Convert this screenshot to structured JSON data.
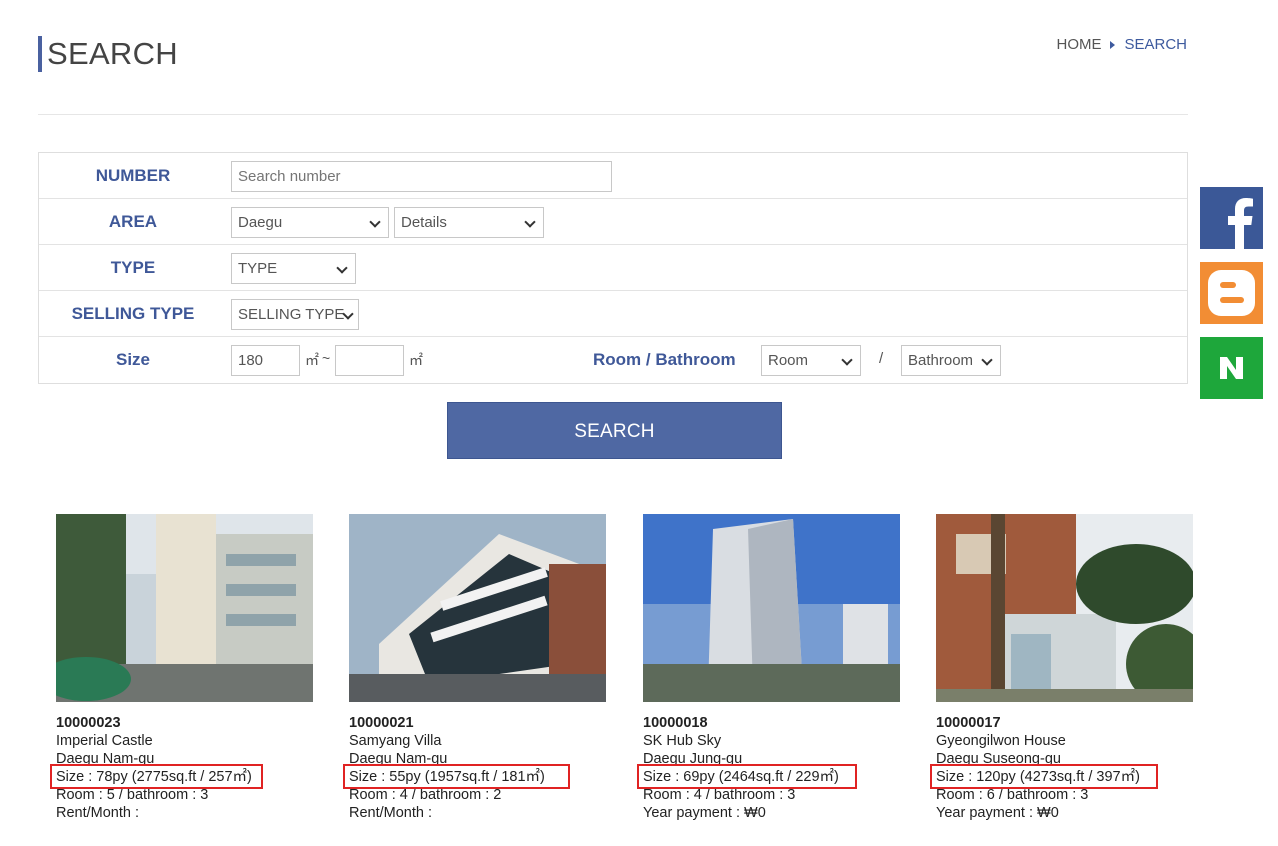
{
  "header": {
    "title": "SEARCH",
    "breadcrumb": {
      "home": "HOME",
      "current": "SEARCH"
    }
  },
  "search_form": {
    "number": {
      "label": "NUMBER",
      "placeholder": "Search number",
      "value": ""
    },
    "area": {
      "label": "AREA",
      "city": "Daegu",
      "details": "Details"
    },
    "type": {
      "label": "TYPE",
      "value": "TYPE"
    },
    "selling_type": {
      "label": "SELLING TYPE",
      "value": "SELLING TYPE"
    },
    "size": {
      "label": "Size",
      "min": "180",
      "max": "",
      "unit": "㎡",
      "separator": "~"
    },
    "room_bathroom": {
      "label": "Room / Bathroom",
      "room": "Room",
      "separator": "/",
      "bathroom": "Bathroom"
    },
    "submit_label": "SEARCH"
  },
  "social": [
    {
      "name": "facebook-icon",
      "color": "#3b5897"
    },
    {
      "name": "blogger-icon",
      "color": "#f28d34"
    },
    {
      "name": "naver-icon",
      "color": "#1ea73b"
    }
  ],
  "listings": [
    {
      "number": "10000023",
      "name": "Imperial Castle",
      "location": "Daegu Nam-gu",
      "size": "Size : 78py (2775sq.ft / 257㎡)",
      "rooms": "Room : 5 / bathroom : 3",
      "payment": "Rent/Month :"
    },
    {
      "number": "10000021",
      "name": "Samyang Villa",
      "location": "Daegu Nam-gu",
      "size": "Size : 55py (1957sq.ft / 181㎡)",
      "rooms": "Room : 4 / bathroom : 2",
      "payment": "Rent/Month :"
    },
    {
      "number": "10000018",
      "name": "SK Hub Sky",
      "location": "Daegu Jung-gu",
      "size": "Size : 69py (2464sq.ft / 229㎡)",
      "rooms": "Room : 4 / bathroom : 3",
      "payment": "Year payment : ₩0"
    },
    {
      "number": "10000017",
      "name": "Gyeongilwon House",
      "location": "Daegu Suseong-gu",
      "size": "Size : 120py (4273sq.ft / 397㎡)",
      "rooms": "Room : 6 / bathroom : 3",
      "payment": "Year payment : ₩0"
    }
  ]
}
